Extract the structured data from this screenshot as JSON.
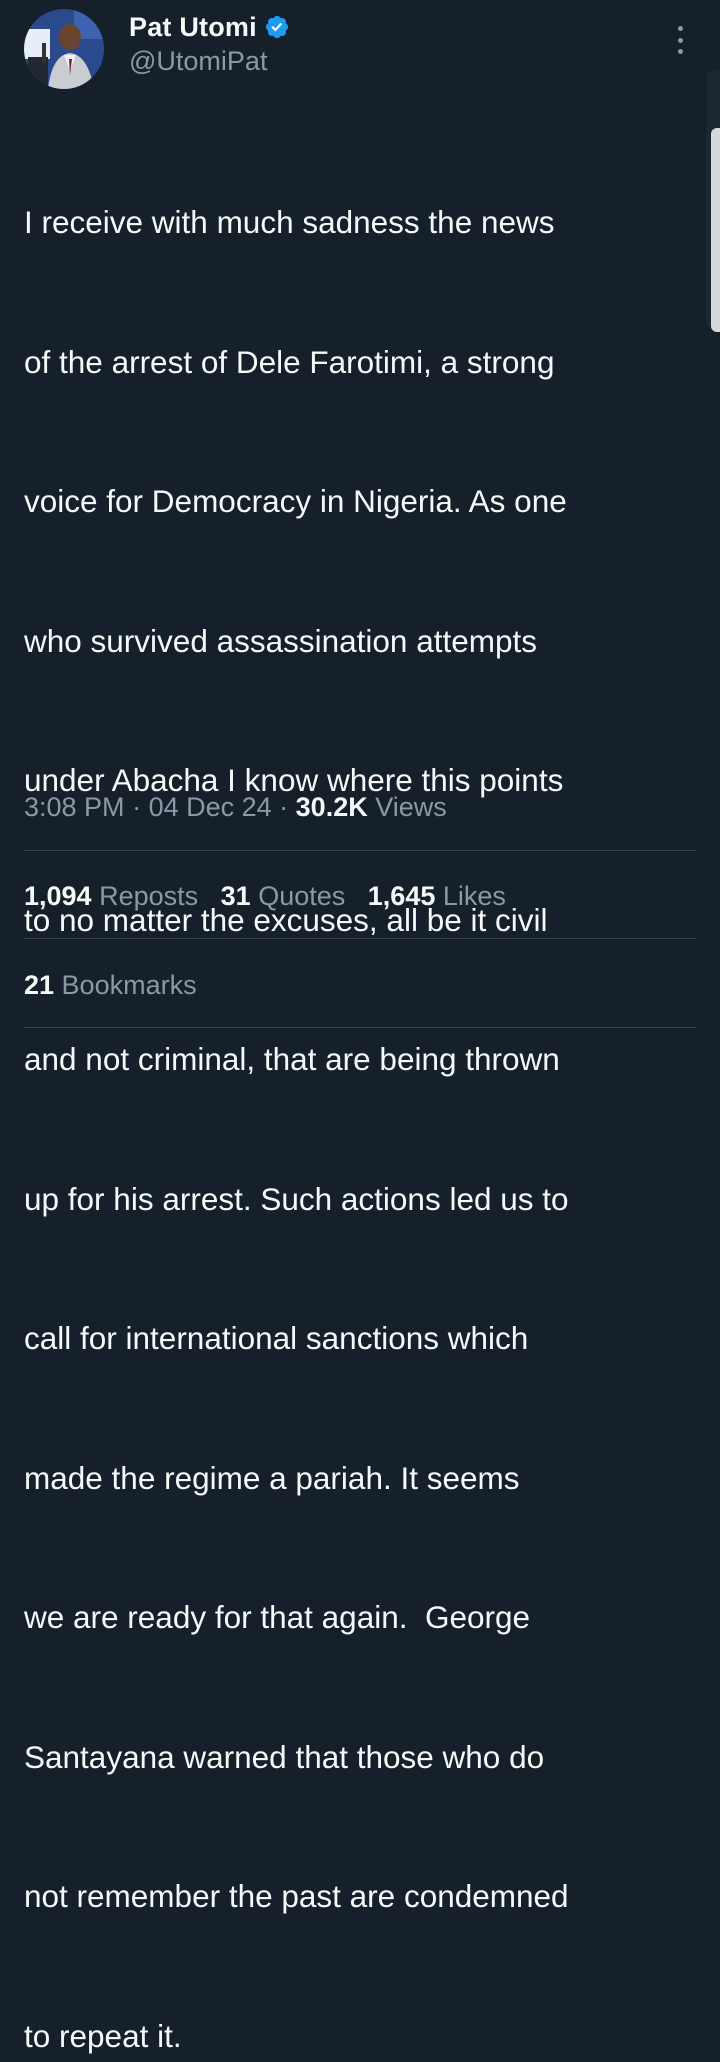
{
  "author": {
    "display_name": "Pat Utomi",
    "handle": "@UtomiPat",
    "verified": true
  },
  "tweet": {
    "lines": [
      "I receive with much sadness the news",
      "of the arrest of Dele Farotimi, a strong",
      "voice for Democracy in Nigeria. As one",
      "who survived assassination attempts",
      "under Abacha I know where this points",
      "to no matter the excuses, all be it civil",
      "and not criminal, that are being thrown",
      "up for his arrest. Such actions led us to",
      "call for international sanctions which",
      "made the regime a pariah. It seems",
      "we are ready for that again.  George",
      "Santayana warned that those who do",
      "not remember the past are condemned",
      "to repeat it."
    ]
  },
  "meta": {
    "time": "3:08 PM",
    "separator": " · ",
    "date": "04 Dec 24",
    "views_count": "30.2K",
    "views_label": " Views"
  },
  "stats": {
    "reposts_count": "1,094",
    "reposts_label": " Reposts",
    "quotes_count": "31",
    "quotes_label": " Quotes",
    "likes_count": "1,645",
    "likes_label": " Likes",
    "bookmarks_count": "21",
    "bookmarks_label": " Bookmarks"
  },
  "colors": {
    "background": "#15202b",
    "text_primary": "#f7f9f9",
    "text_secondary": "#8b98a5",
    "divider": "#38444d",
    "verified_badge": "#1d9bf0"
  },
  "icons": {
    "verified": "verified-badge-icon",
    "more": "more-options-icon"
  }
}
